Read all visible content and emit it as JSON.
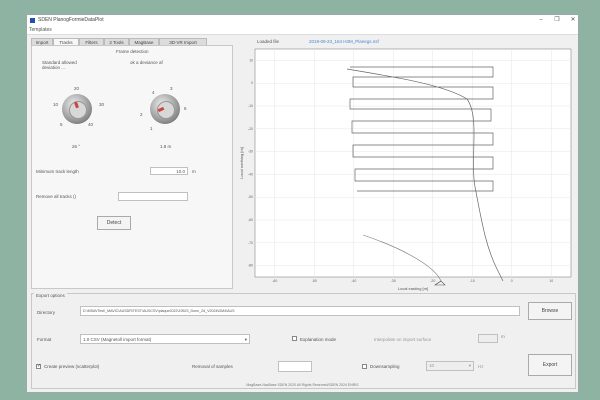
{
  "window": {
    "title": "SDEN PlanogFormieDataPlot",
    "min": "–",
    "max": "❐",
    "close": "✕"
  },
  "menu": {
    "items": [
      "Templates"
    ]
  },
  "tabs": [
    {
      "label": "Import"
    },
    {
      "label": "Tracks"
    },
    {
      "label": "Filters"
    },
    {
      "label": "2 Tools"
    },
    {
      "label": "MagBase"
    },
    {
      "label": "3D-VR Import"
    }
  ],
  "tracks_panel": {
    "heading": "Frame detection",
    "standard_label": "Standard allowed deviation ...",
    "angle_label": "ok a deviance af",
    "knob1": {
      "scale": [
        "20",
        "10",
        "30",
        "5",
        "40"
      ],
      "value": "26",
      "unit": "°"
    },
    "knob2": {
      "scale": [
        "4",
        "3",
        "2",
        "1",
        "6"
      ],
      "value": "1.8",
      "unit": "m"
    },
    "min_track_label": "Minimum track length",
    "min_track_value": "10.0",
    "min_track_unit": "m",
    "remove_label": "Remove all tracks ()",
    "remove_value": "",
    "detect_button": "Detect"
  },
  "plot": {
    "loaded_file_label": "Loaded file",
    "loaded_file_value": "2019-09-23_164 H3M_Planegs.nsf",
    "xlabel": "Local easting [m]",
    "ylabel": "Local northing [m]",
    "x_ticks": [
      "-60",
      "-50",
      "-40",
      "-30",
      "-20",
      "-10",
      "0",
      "10"
    ],
    "y_ticks": [
      "10",
      "0",
      "-10",
      "-20",
      "-30",
      "-40",
      "-50",
      "-60",
      "-70",
      "-80"
    ]
  },
  "export": {
    "group_label": "Export options",
    "directory_label": "Directory",
    "directory_value": "D:\\MSAVTest\\_MAVIC\\AUSDR\\TEST\\AUSCSV\\plaque2022\\19523_Dunn_2d_V2024\\DM4\\AUS",
    "browse_button": "Browse",
    "format_label": "Format",
    "format_value": "1.0 CSV (Magnetoll import format)",
    "explanation_label": "Explanation mode",
    "interpolation_label": "Interpolate on import surface",
    "interpolation_value": "",
    "interpolation_unit": "m",
    "preview_label": "Create preview (scatterplot)",
    "removal_label": "Removal of samples",
    "removal_value": "",
    "downsampling_label": "Downsampling",
    "downsampling_value": "10",
    "downsampling_unit": "Hz",
    "export_button": "Export",
    "footer": "MagBase-NavBase SDEN 2020 All Rights Reserved/SDEN 2024 ENRIS"
  }
}
